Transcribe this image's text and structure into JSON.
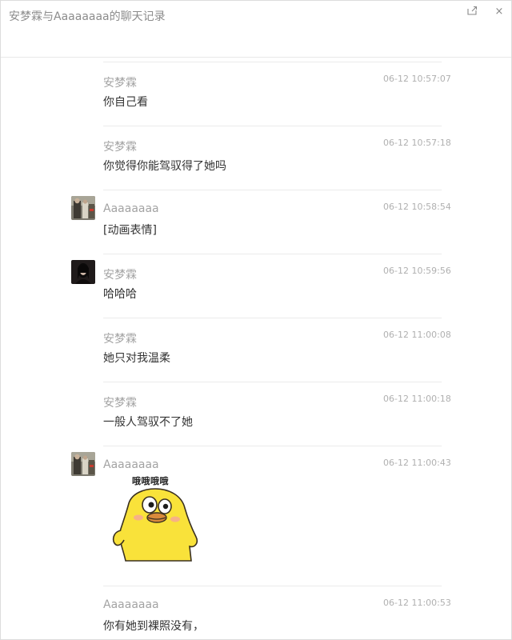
{
  "window": {
    "title": "安梦霖与Aaaaaaaa的聊天记录",
    "share_icon": "share-icon",
    "close_icon": "close-icon",
    "close_glyph": "×",
    "share_glyph": "⇱"
  },
  "messages": [
    {
      "sender": "安梦霖",
      "time": "06-12 10:57:07",
      "text": "你自己看",
      "avatar": "none"
    },
    {
      "sender": "安梦霖",
      "time": "06-12 10:57:18",
      "text": "你觉得你能驾驭得了她吗",
      "avatar": "none"
    },
    {
      "sender": "Aaaaaaaa",
      "time": "06-12 10:58:54",
      "text": "[动画表情]",
      "avatar": "photo-avatar-aaaaaaaa"
    },
    {
      "sender": "安梦霖",
      "time": "06-12 10:59:56",
      "text": "哈哈哈",
      "avatar": "photo-avatar-anmenglin"
    },
    {
      "sender": "安梦霖",
      "time": "06-12 11:00:08",
      "text": "她只对我温柔",
      "avatar": "none"
    },
    {
      "sender": "安梦霖",
      "time": "06-12 11:00:18",
      "text": "一般人驾驭不了她",
      "avatar": "none"
    },
    {
      "sender": "Aaaaaaaa",
      "time": "06-12 11:00:43",
      "sticker_caption": "哦哦哦哦",
      "sticker": "yellow-duck-sticker",
      "avatar": "photo-avatar-aaaaaaaa"
    },
    {
      "sender": "Aaaaaaaa",
      "time": "06-12 11:00:53",
      "text": "你有她到裸照没有，",
      "avatar": "none"
    }
  ],
  "colors": {
    "sender": "#a3a3a3",
    "time": "#b0b0b0",
    "text": "#333333",
    "title": "#8c8c8c",
    "sticker_yellow": "#f9e23a"
  }
}
